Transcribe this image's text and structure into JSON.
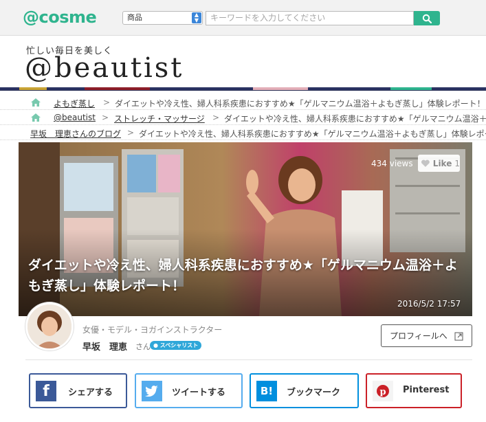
{
  "header": {
    "logo": "@cosme",
    "category_select": "商品",
    "search_placeholder": "キーワードを入力してください",
    "tagline": "忙しい毎日を美しく",
    "brand": "@beautist",
    "stripe_colors": [
      "#2b3362",
      "#c9a436",
      "#2b3362",
      "#8d1f2a",
      "#2b3362",
      "#e3aeb8",
      "#2b3362",
      "#2fb48e",
      "#2b3362"
    ]
  },
  "breadcrumbs": {
    "row1": [
      "よもぎ蒸し",
      "ダイエットや冷え性、婦人科系疾患におすすめ★「ゲルマニウム温浴＋よもぎ蒸し」体験レポート！"
    ],
    "row2": [
      "@beautist",
      "ストレッチ・マッサージ",
      "ダイエットや冷え性、婦人科系疾患におすすめ★「ゲルマニウム温浴＋よもぎ蒸し」体験レポート！"
    ],
    "row3": [
      "早坂　理恵さんのブログ",
      "ダイエットや冷え性、婦人科系疾患におすすめ★「ゲルマニウム温浴＋よもぎ蒸し」体験レポート！"
    ],
    "separator": ">"
  },
  "article": {
    "title": "ダイエットや冷え性、婦人科系疾患におすすめ★「ゲルマニウム温浴＋よもぎ蒸し」体験レポート！",
    "views": "434 views",
    "like_label": "Like",
    "like_count": "1",
    "date": "2016/5/2 17:57"
  },
  "author": {
    "role": "女優・モデル・ヨガインストラクター",
    "name": "早坂　理恵",
    "honorific": "さん",
    "badge": "スペシャリスト",
    "profile_button": "プロフィールへ"
  },
  "share": {
    "facebook": "シェアする",
    "twitter": "ツイートする",
    "hatena": "ブックマーク",
    "pinterest": "Pinterest",
    "colors": {
      "facebook": "#3b5998",
      "twitter": "#55acee",
      "hatena": "#008fde",
      "pinterest": "#cb2027"
    }
  }
}
